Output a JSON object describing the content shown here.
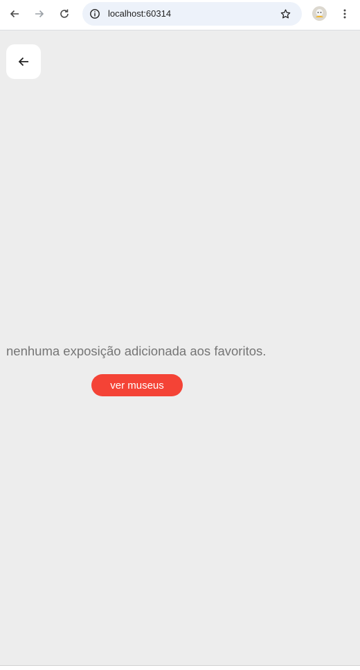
{
  "browser": {
    "url": "localhost:60314",
    "icons": {
      "back": "arrow-left-icon",
      "forward": "arrow-right-icon",
      "reload": "reload-icon",
      "site_info": "info-icon",
      "bookmark": "star-icon",
      "profile": "avatar",
      "menu": "kebab-menu-icon"
    }
  },
  "app": {
    "back_icon": "arrow-left-icon",
    "empty_message": "nenhuma exposição adicionada aos favoritos.",
    "cta_label": "ver museus",
    "colors": {
      "background": "#ededed",
      "accent": "#f44336",
      "message_text": "#757575"
    }
  }
}
